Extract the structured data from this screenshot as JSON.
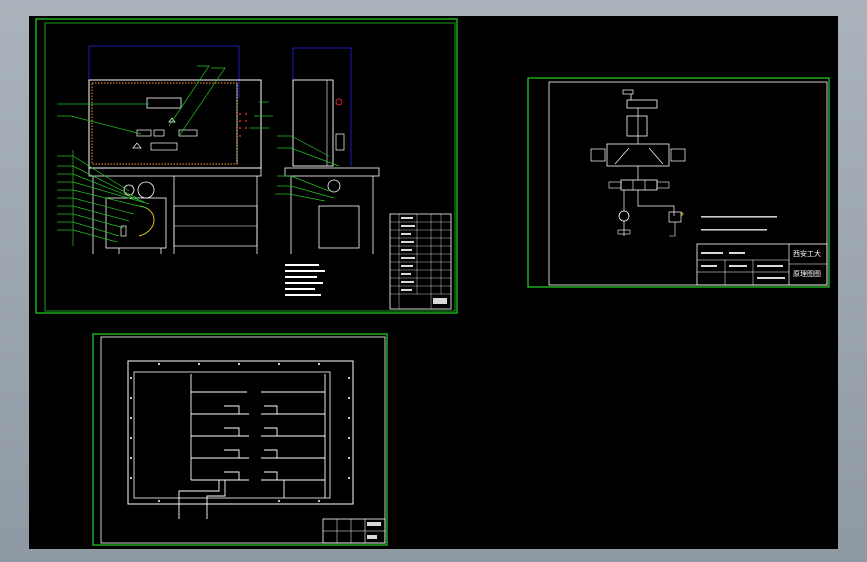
{
  "viewer": {
    "background_color": "#000000",
    "frame_color": "#9ba4ad",
    "border_color": "#22c322"
  },
  "sheets": [
    {
      "name": "equipment-assembly-drawing",
      "content": "front-view-and-side-view-of-test-bench"
    },
    {
      "name": "hydraulic-schematic",
      "content": "hydraulic-circuit-with-cylinder-valves-pump",
      "title_block": {
        "line1": "西安工大",
        "line2": "原理图图"
      }
    },
    {
      "name": "panel-layout-drawing",
      "content": "pipe-routing-on-mounting-plate"
    }
  ]
}
